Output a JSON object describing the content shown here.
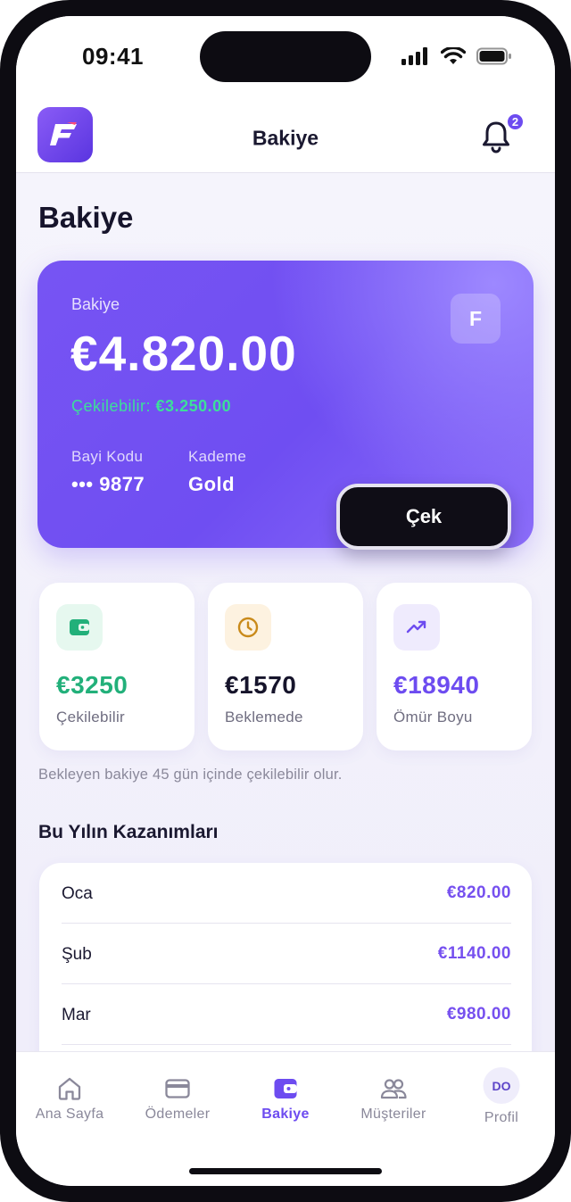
{
  "status_bar": {
    "time": "09:41"
  },
  "header": {
    "title": "Bakiye",
    "notification_count": "2",
    "logo_letter": "F"
  },
  "page": {
    "title": "Bakiye"
  },
  "balance_card": {
    "label": "Bakiye",
    "amount": "€4.820.00",
    "withdrawable_label": "Çekilebilir:",
    "withdrawable_value": "€3.250.00",
    "badge_letter": "F",
    "dealer_code_label": "Bayi Kodu",
    "dealer_code_value": "••• 9877",
    "tier_label": "Kademe",
    "tier_value": "Gold",
    "withdraw_button": "Çek"
  },
  "stats": [
    {
      "value": "€3250",
      "label": "Çekilebilir",
      "icon": "wallet-icon",
      "color": "#22b07a",
      "bg": "#e6f8ef"
    },
    {
      "value": "€1570",
      "label": "Beklemede",
      "icon": "clock-icon",
      "color": "#16142b",
      "bg": "#fdf2e0"
    },
    {
      "value": "€18940",
      "label": "Ömür Boyu",
      "icon": "trend-up-icon",
      "color": "#6d4cf0",
      "bg": "#efebfd"
    }
  ],
  "info_note": "Bekleyen bakiye 45 gün içinde çekilebilir olur.",
  "earnings": {
    "title": "Bu Yılın Kazanımları",
    "rows": [
      {
        "month": "Oca",
        "amount": "€820.00"
      },
      {
        "month": "Şub",
        "amount": "€1140.00"
      },
      {
        "month": "Mar",
        "amount": "€980.00"
      }
    ]
  },
  "nav": {
    "items": [
      {
        "label": "Ana Sayfa",
        "icon": "home-icon"
      },
      {
        "label": "Ödemeler",
        "icon": "card-icon"
      },
      {
        "label": "Bakiye",
        "icon": "wallet-icon"
      },
      {
        "label": "Müşteriler",
        "icon": "users-icon"
      },
      {
        "label": "Profil",
        "avatar": "DO"
      }
    ],
    "active": "Bakiye"
  },
  "colors": {
    "accent": "#6d4cf0",
    "positive": "#22b07a"
  }
}
